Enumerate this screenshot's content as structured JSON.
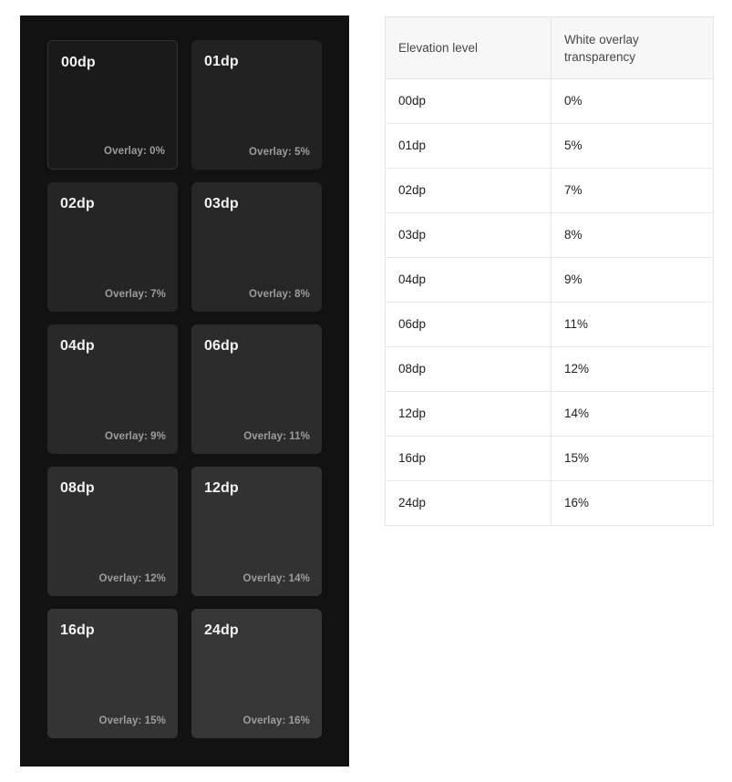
{
  "panel": {
    "name": "dark-theme-elevation-swatches",
    "background_color": "#121212",
    "cards": [
      {
        "title": "00dp",
        "overlay_label": "Overlay: 0%",
        "overlay_percent": 0,
        "bg_color": "#1a1a1a",
        "bordered": true
      },
      {
        "title": "01dp",
        "overlay_label": "Overlay: 5%",
        "overlay_percent": 5,
        "bg_color": "#222222",
        "bordered": false
      },
      {
        "title": "02dp",
        "overlay_label": "Overlay: 7%",
        "overlay_percent": 7,
        "bg_color": "#252525",
        "bordered": false
      },
      {
        "title": "03dp",
        "overlay_label": "Overlay: 8%",
        "overlay_percent": 8,
        "bg_color": "#272727",
        "bordered": false
      },
      {
        "title": "04dp",
        "overlay_label": "Overlay: 9%",
        "overlay_percent": 9,
        "bg_color": "#292929",
        "bordered": false
      },
      {
        "title": "06dp",
        "overlay_label": "Overlay: 11%",
        "overlay_percent": 11,
        "bg_color": "#2c2c2c",
        "bordered": false
      },
      {
        "title": "08dp",
        "overlay_label": "Overlay: 12%",
        "overlay_percent": 12,
        "bg_color": "#2e2e2e",
        "bordered": false
      },
      {
        "title": "12dp",
        "overlay_label": "Overlay: 14%",
        "overlay_percent": 14,
        "bg_color": "#323232",
        "bordered": false
      },
      {
        "title": "16dp",
        "overlay_label": "Overlay: 15%",
        "overlay_percent": 15,
        "bg_color": "#343434",
        "bordered": false
      },
      {
        "title": "24dp",
        "overlay_label": "Overlay: 16%",
        "overlay_percent": 16,
        "bg_color": "#363636",
        "bordered": false
      }
    ]
  },
  "table": {
    "headers": [
      "Elevation level",
      "White overlay transparency"
    ],
    "rows": [
      [
        "00dp",
        "0%"
      ],
      [
        "01dp",
        "5%"
      ],
      [
        "02dp",
        "7%"
      ],
      [
        "03dp",
        "8%"
      ],
      [
        "04dp",
        "9%"
      ],
      [
        "06dp",
        "11%"
      ],
      [
        "08dp",
        "12%"
      ],
      [
        "12dp",
        "14%"
      ],
      [
        "16dp",
        "15%"
      ],
      [
        "24dp",
        "16%"
      ]
    ]
  },
  "colors": {
    "page_background": "#ffffff",
    "panel_background": "#121212",
    "card_title_text": "#f2f2f2",
    "card_overlay_text": "#9d9d9d",
    "table_border": "#e4e4e4",
    "table_header_background": "#f7f7f7",
    "table_header_text": "#474747",
    "table_cell_text": "#1f1f1f"
  }
}
